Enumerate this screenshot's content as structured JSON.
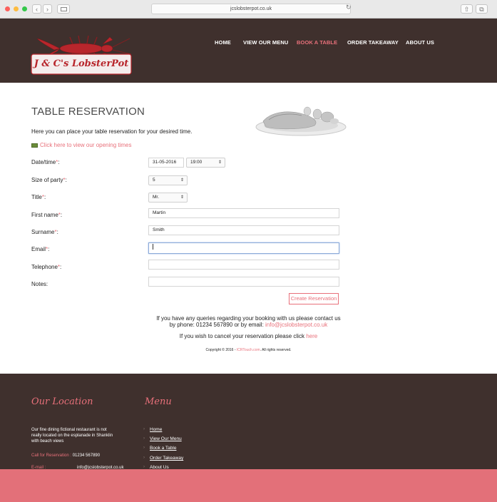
{
  "browser": {
    "url": "jcslobsterpot.co.uk",
    "back_icon": "‹",
    "forward_icon": "›",
    "reload_icon": "↻",
    "share_icon": "⇧",
    "tabs_icon": "⧉"
  },
  "nav": {
    "items": [
      {
        "label": "HOME"
      },
      {
        "label": "VIEW OUR MENU"
      },
      {
        "label": "BOOK A TABLE"
      },
      {
        "label": "ORDER TAKEAWAY"
      },
      {
        "label": "ABOUT US"
      }
    ]
  },
  "logo": {
    "text": "J & C's LobsterPot"
  },
  "page": {
    "title": "TABLE RESERVATION",
    "intro": "Here you can place your table reservation for your desired time.",
    "opening_times_link": "Click here to view our opening times"
  },
  "form": {
    "datetime_label": "Date/time",
    "date_value": "31-05-2016",
    "time_value": "19:00",
    "party_label": "Size of party",
    "party_value": "5",
    "title_label": "Title",
    "title_value": "Mr.",
    "firstname_label": "First name",
    "firstname_value": "Martin",
    "surname_label": "Surname",
    "surname_value": "Smith",
    "email_label": "Email",
    "email_value": "",
    "telephone_label": "Telephone",
    "telephone_value": "",
    "notes_label": "Notes:",
    "notes_value": "",
    "required_mark": "*",
    "colon": ":",
    "submit_label": "Create Reservation"
  },
  "contact": {
    "line1": "If you have any queries regarding your booking with us please contact us",
    "line2_prefix": "by phone: 01234 567890 or by email:",
    "email": "info@jcslobsterpot.co.uk",
    "cancel_prefix": "If you wish to cancel your reservation please click",
    "cancel_link": "here"
  },
  "copyright": {
    "prefix": "Copyright © 2016 -",
    "link": "ICRTouch.com",
    "suffix": ". All rights reserved."
  },
  "footer": {
    "location_heading": "Our Location",
    "location_text": [
      "Our fine dining fictional restaurant is not",
      "really located on the esplanade in Shanklin",
      "with beach views"
    ],
    "call_label": "Call for Reservation :",
    "call_value": "01234 567890",
    "email_label": "E-mail :",
    "email_value": "info@jcslobsterpot.co.uk",
    "menu_heading": "Menu",
    "menu_items": [
      {
        "label": "Home"
      },
      {
        "label": "View Our Menu"
      },
      {
        "label": "Book a Table"
      },
      {
        "label": "Order Takeaway"
      },
      {
        "label": "About Us"
      }
    ],
    "chevron": "›"
  },
  "colors": {
    "accent": "#e8707a",
    "dark": "#3f302d",
    "strip": "#e37079"
  }
}
